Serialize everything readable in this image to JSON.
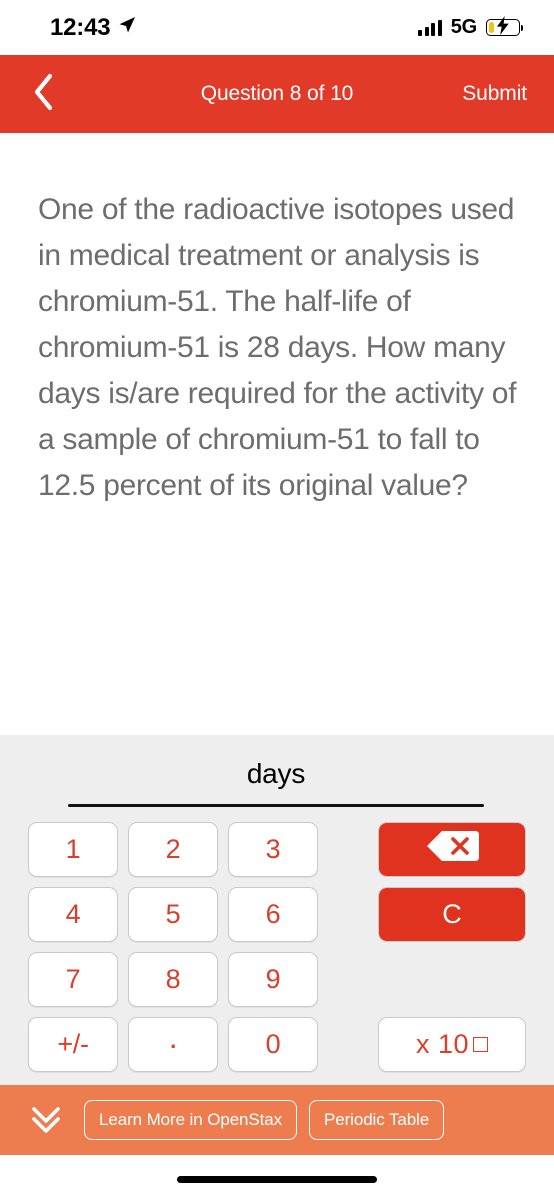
{
  "status_bar": {
    "time": "12:43",
    "location_icon": "location-arrow-icon",
    "signal_icon": "cellular-signal-icon",
    "network": "5G",
    "battery_icon": "battery-charging-icon",
    "battery_level_percent": 18,
    "battery_fill_color": "#f2c31c"
  },
  "nav_bar": {
    "back_icon": "chevron-left-icon",
    "title": "Question 8 of 10",
    "submit_label": "Submit",
    "background_color": "#e23a28",
    "text_color": "#ffffff"
  },
  "question": {
    "text": "One of the radioactive isotopes used in medical treatment or analysis is chromium-51. The half-life of chromium-51 is 28 days. How many days is/are required for the activity of a sample of chromium-51 to fall to 12.5 percent of its original value?",
    "text_color": "#6d6d6d"
  },
  "answer": {
    "value": "",
    "unit_label": "days",
    "underline_color": "#111111"
  },
  "keypad": {
    "accent_color": "#d9402b",
    "panel_background": "#eeeeee",
    "keys": [
      {
        "label": "1",
        "name": "key-1"
      },
      {
        "label": "2",
        "name": "key-2"
      },
      {
        "label": "3",
        "name": "key-3"
      },
      {
        "label": "4",
        "name": "key-4"
      },
      {
        "label": "5",
        "name": "key-5"
      },
      {
        "label": "6",
        "name": "key-6"
      },
      {
        "label": "7",
        "name": "key-7"
      },
      {
        "label": "8",
        "name": "key-8"
      },
      {
        "label": "9",
        "name": "key-9"
      },
      {
        "label": "+/-",
        "name": "key-plus-minus"
      },
      {
        "label": ".",
        "name": "key-decimal"
      },
      {
        "label": "0",
        "name": "key-0"
      }
    ],
    "backspace": {
      "icon": "backspace-delete-icon",
      "background": "#e0331f"
    },
    "clear": {
      "label": "C",
      "background": "#e0331f"
    },
    "exponent": {
      "label": "x 10",
      "superscript_placeholder": "empty-box"
    }
  },
  "bottom_bar": {
    "background_color": "#ed7d4f",
    "collapse_icon": "double-chevron-down-icon",
    "buttons": [
      {
        "label": "Learn More in OpenStax",
        "name": "learn-more-openstax-button"
      },
      {
        "label": "Periodic Table",
        "name": "periodic-table-button"
      }
    ]
  },
  "home_indicator": {
    "present": true
  }
}
